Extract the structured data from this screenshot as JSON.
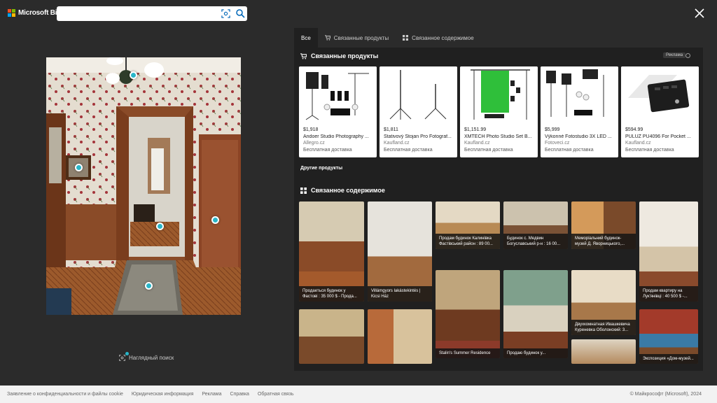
{
  "header": {
    "logo_text": "Microsoft Bing",
    "search_placeholder": "",
    "search_value": ""
  },
  "icons": {
    "visual_search": "visual-search-icon",
    "search": "search-icon",
    "close": "close-icon",
    "cart": "cart-icon",
    "grid": "grid-icon"
  },
  "colors": {
    "accent": "#29b6c9",
    "panel": "#202020",
    "page": "#2b2b2b"
  },
  "left": {
    "visual_search_label": "Наглядный поиск"
  },
  "tabs": [
    {
      "label": "Все"
    },
    {
      "label": "Связанные продукты"
    },
    {
      "label": "Связанное содержимое"
    }
  ],
  "products_section": {
    "title": "Связанные продукты",
    "ads_label": "Реклама",
    "more_label": "Другие продукты",
    "items": [
      {
        "price": "$1,918",
        "name": "Andoer Studio Photography ...",
        "shop": "Allegro.cz",
        "shipping": "Бесплатная доставка"
      },
      {
        "price": "$1,811",
        "name": "Stativový Stojan Pro Fotograf...",
        "shop": "Kaufland.cz",
        "shipping": "Бесплатная доставка"
      },
      {
        "price": "$1,151.99",
        "name": "XMTECH Photo Studio Set B...",
        "shop": "Kaufland.cz",
        "shipping": "Бесплатная доставка"
      },
      {
        "price": "$5,999",
        "name": "Výkonné Fotostudio 3X LED ...",
        "shop": "Fotoveci.cz",
        "shipping": "Бесплатная доставка"
      },
      {
        "price": "$594.99",
        "name": "PULUZ PU4096 For Pocket ...",
        "shop": "Kaufland.cz",
        "shipping": "Бесплатная доставка"
      }
    ]
  },
  "content_section": {
    "title": "Связанное содержимое",
    "tiles": [
      {
        "caption": "Продаеться будинок у Фастові : 35 000 $ - Прода..."
      },
      {
        "caption": "Villámgyors lakástekintés | Kicsi Ház"
      },
      {
        "caption": "Продам будинок Калинівка Фастівський район : 89 00..."
      },
      {
        "caption": "Будинок с. Медвин Богуславський р-н : 16 00..."
      },
      {
        "caption": "Меморіальний будинок-музей Д. Яворницького,..."
      },
      {
        "caption": "Продам квартиру на Лук'янівці : 40 500 $ -..."
      },
      {
        "caption": "Двухкомнатная Ивашкевича Куреневка Оболонский: 3..."
      },
      {
        "caption": "Экспозиция «Дом-музей..."
      },
      {
        "caption": "Stalin's Summer Residence"
      },
      {
        "caption": "Продаю будинок у..."
      }
    ]
  },
  "footer": {
    "links": [
      {
        "label": "Заявление о конфиденциальности и файлы cookie"
      },
      {
        "label": "Юридическая информация"
      },
      {
        "label": "Реклама"
      },
      {
        "label": "Справка"
      },
      {
        "label": "Обратная связь"
      }
    ],
    "copyright": "© Майкрософт (Microsoft), 2024"
  }
}
